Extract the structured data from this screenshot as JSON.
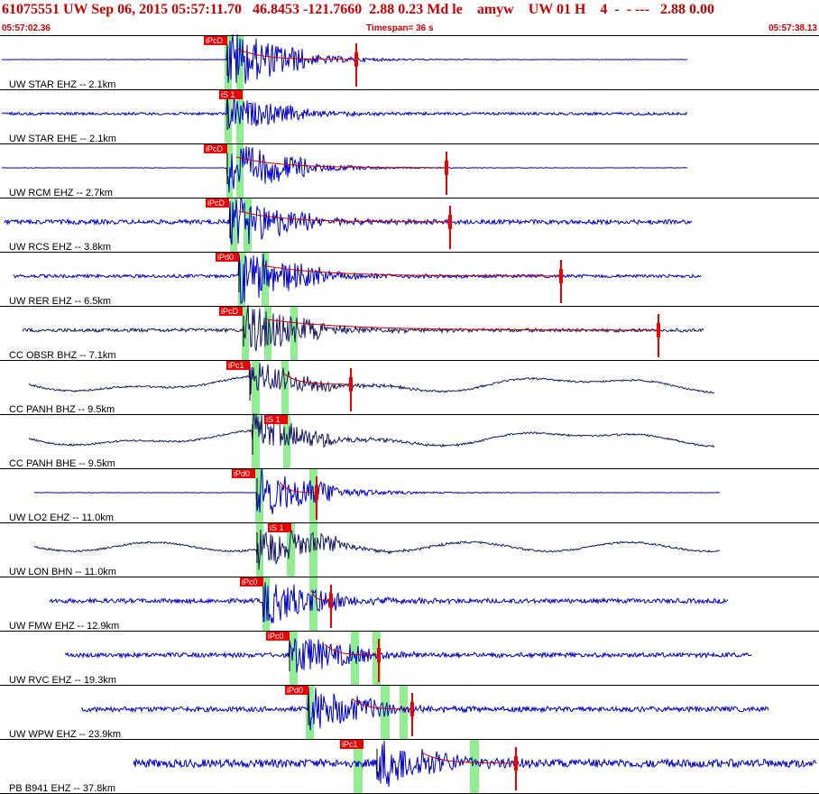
{
  "header": {
    "title": "61075551 UW Sep 06, 2015 05:57:11.70   46.8453 -121.7660  2.88 0.23 Md le    amyw    UW 01 H    4  -  - ---   2.88 0.00",
    "start_time": "05:57:02.36",
    "timespan": "Timespan=  36 s",
    "end_time": "05:57:38.13"
  },
  "colors": {
    "header_text": "#cc0000",
    "trace_blue": "#0000cc",
    "trace_dark": "#1a1a66",
    "pick_box": "#ee0000",
    "coda_line": "#cc0000",
    "window_green": "#90ee90",
    "separator": "#000000"
  },
  "channels": [
    {
      "label": "UW STAR EHZ -- 2.1km",
      "pick": "iPcD",
      "trace": "blue"
    },
    {
      "label": "UW STAR EHE -- 2.1km",
      "pick": "iS 1",
      "trace": "blue"
    },
    {
      "label": "UW RCM EHZ -- 2.7km",
      "pick": "iPcD",
      "trace": "blue"
    },
    {
      "label": "UW RCS EHZ -- 3.8km",
      "pick": "iPcD",
      "trace": "blue"
    },
    {
      "label": "UW RER EHZ -- 6.5km",
      "pick": "iPd0",
      "trace": "blue"
    },
    {
      "label": "CC OBSR BHZ -- 7.1km",
      "pick": "iPcD",
      "trace": "dark"
    },
    {
      "label": "CC PANH BHZ -- 9.5km",
      "pick": "iPc1",
      "trace": "dark"
    },
    {
      "label": "CC PANH BHE -- 9.5km",
      "pick": "iS 1",
      "trace": "dark"
    },
    {
      "label": "UW LO2 EHZ -- 11.0km",
      "pick": "iPd0",
      "trace": "blue"
    },
    {
      "label": "UW LON BHN -- 11.0km",
      "pick": "iS 1",
      "trace": "dark"
    },
    {
      "label": "UW FMW EHZ -- 12.9km",
      "pick": "iPc0",
      "trace": "blue"
    },
    {
      "label": "UW RVC EHZ -- 19.3km",
      "pick": "iPc0",
      "trace": "blue"
    },
    {
      "label": "UW WPW EHZ -- 23.9km",
      "pick": "iPd0",
      "trace": "blue"
    },
    {
      "label": "PB B941 EHZ -- 37.8km",
      "pick": "iPc1",
      "trace": "blue"
    }
  ]
}
